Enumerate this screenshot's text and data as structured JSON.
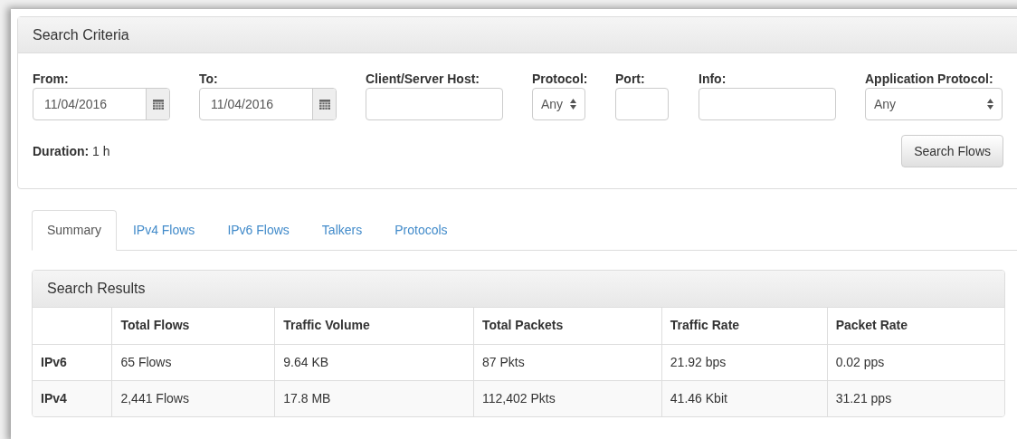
{
  "search_criteria": {
    "title": "Search Criteria",
    "fields": [
      {
        "kind": "date",
        "label": "From:",
        "value": "11/04/2016"
      },
      {
        "kind": "date",
        "label": "To:",
        "value": "11/04/2016"
      },
      {
        "kind": "text",
        "label": "Client/Server Host:"
      },
      {
        "kind": "select",
        "label": "Protocol:",
        "value": "Any"
      },
      {
        "kind": "port",
        "label": "Port:"
      },
      {
        "kind": "text",
        "label": "Info:"
      },
      {
        "kind": "wideselect",
        "label": "Application Protocol:",
        "value": "Any"
      }
    ],
    "duration": {
      "label": "Duration:",
      "value": "1 h"
    },
    "button": "Search Flows"
  },
  "tabs": [
    {
      "label": "Summary",
      "selected": true
    },
    {
      "label": "IPv4 Flows",
      "selected": false
    },
    {
      "label": "IPv6 Flows",
      "selected": false
    },
    {
      "label": "Talkers",
      "selected": false
    },
    {
      "label": "Protocols",
      "selected": false
    }
  ],
  "search_results": {
    "title": "Search Results",
    "columns": [
      "Total Flows",
      "Traffic Volume",
      "Total Packets",
      "Traffic Rate",
      "Packet Rate"
    ],
    "rows": [
      {
        "label": "IPv6",
        "cells": [
          "65 Flows",
          "9.64 KB",
          "87 Pkts",
          "21.92 bps",
          "0.02 pps"
        ]
      },
      {
        "label": "IPv4",
        "cells": [
          "2,441 Flows",
          "17.8 MB",
          "112,402 Pkts",
          "41.46 Kbit",
          "31.21 pps"
        ]
      }
    ]
  }
}
